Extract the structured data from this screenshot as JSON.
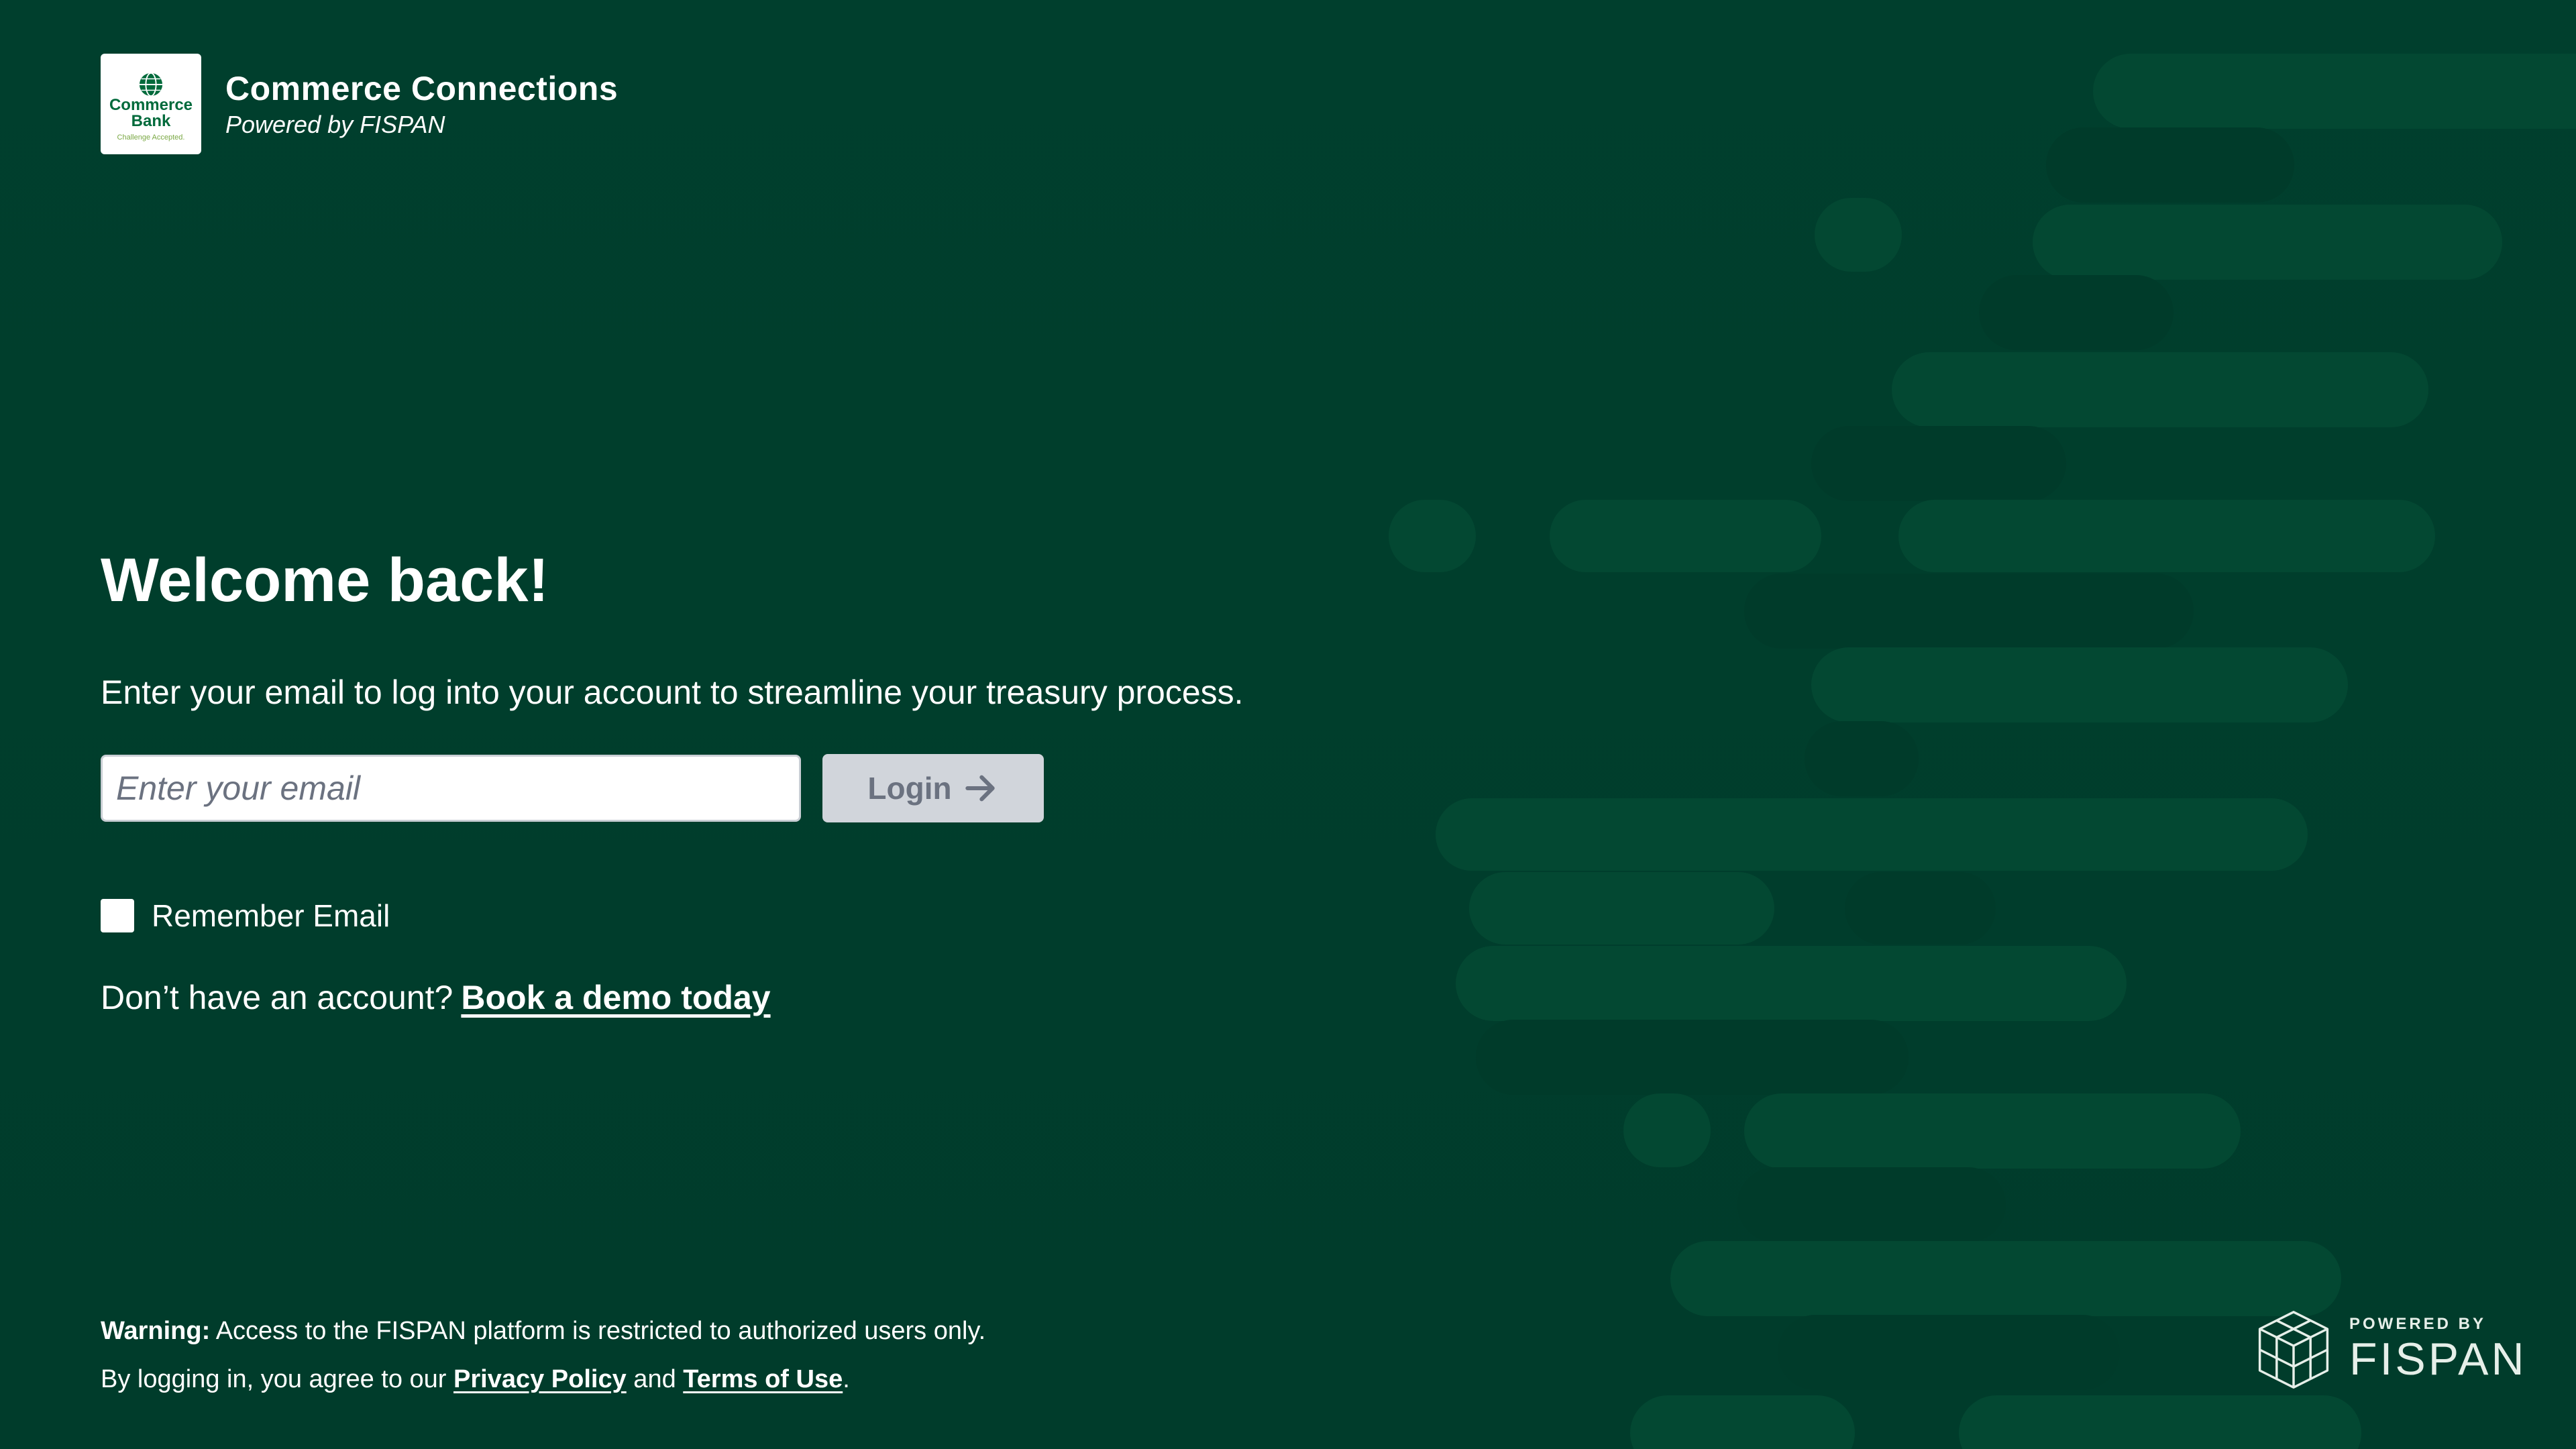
{
  "brand": {
    "logo_line1": "Commerce",
    "logo_line2": "Bank",
    "logo_tagline": "Challenge Accepted.",
    "title": "Commerce Connections",
    "subtitle": "Powered by FISPAN"
  },
  "main": {
    "heading": "Welcome back!",
    "description": "Enter your email to log into your account to streamline your treasury process.",
    "email_placeholder": "Enter your email",
    "email_value": "",
    "login_label": "Login",
    "remember_label": "Remember Email",
    "remember_checked": false,
    "no_account_text": "Don’t have an account?",
    "demo_link": "Book a demo today"
  },
  "footer": {
    "warning_label": "Warning:",
    "warning_text": " Access to the FISPAN platform is restricted to authorized users only.",
    "agree_prefix": "By logging in, you agree to our ",
    "privacy_link": "Privacy Policy",
    "and_text": " and ",
    "terms_link": "Terms of Use",
    "period": "."
  },
  "powered": {
    "label": "POWERED BY",
    "name": "FISPAN"
  },
  "colors": {
    "background": "#003e2d",
    "pill": "#00513a",
    "button_disabled": "#d1d5db",
    "brand_green": "#006a3b"
  },
  "icons": {
    "logo": "commerce-bank-globe-icon",
    "login": "arrow-right-icon",
    "powered": "fispan-cube-icon"
  }
}
